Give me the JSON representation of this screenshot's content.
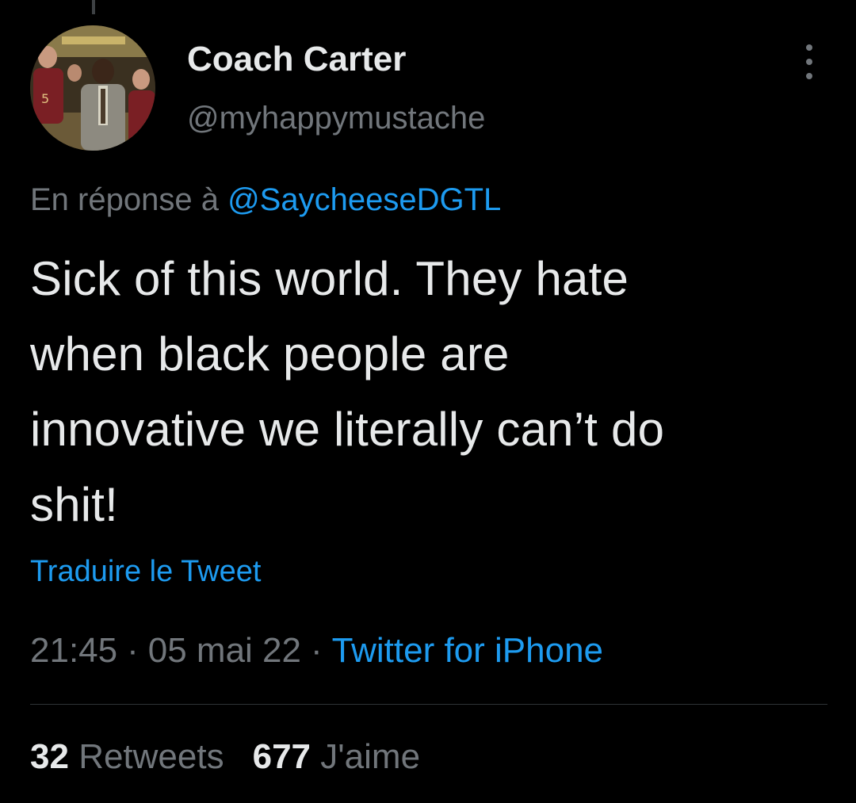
{
  "tweet": {
    "author": {
      "display_name": "Coach Carter",
      "handle": "@myhappymustache"
    },
    "reply": {
      "prefix": "En réponse à ",
      "to_handle": "@SaycheeseDGTL"
    },
    "text_lines": [
      "Sick of this world. They hate",
      "when black people are",
      "innovative we literally can’t do",
      "shit!"
    ],
    "translate_label": "Traduire le Tweet",
    "meta": {
      "time": "21:45",
      "separator": "·",
      "date": "05 mai 22",
      "source": "Twitter for iPhone"
    },
    "stats": {
      "retweets_count": "32",
      "retweets_label": "Retweets",
      "likes_count": "677",
      "likes_label": "J'aime"
    }
  },
  "icons": {
    "more": "more-vertical-icon"
  },
  "colors": {
    "background": "#000000",
    "text_primary": "#e7e9ea",
    "text_secondary": "#71767b",
    "link": "#1d9bf0",
    "divider": "#2f3336"
  }
}
